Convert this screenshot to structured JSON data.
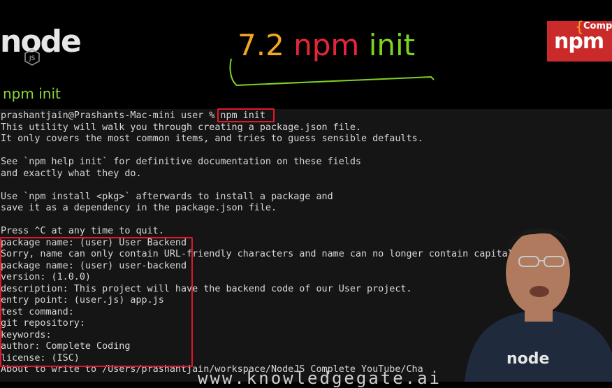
{
  "header": {
    "node_logo_text": "node",
    "slide_title_number": "7.2",
    "slide_title_cmd1": "npm",
    "slide_title_cmd2": "init",
    "subtitle": "npm init",
    "npm_badge_text": "npm",
    "npm_badge_tag": "Comp"
  },
  "terminal": {
    "lines": [
      "prashantjain@Prashants-Mac-mini user % npm init",
      "This utility will walk you through creating a package.json file.",
      "It only covers the most common items, and tries to guess sensible defaults.",
      "",
      "See `npm help init` for definitive documentation on these fields",
      "and exactly what they do.",
      "",
      "Use `npm install <pkg>` afterwards to install a package and",
      "save it as a dependency in the package.json file.",
      "",
      "Press ^C at any time to quit.",
      "package name: (user) User Backend",
      "Sorry, name can only contain URL-friendly characters and name can no longer contain capital",
      "package name: (user) user-backend",
      "version: (1.0.0)",
      "description: This project will have the backend code of our User project.",
      "entry point: (user.js) app.js",
      "test command:",
      "git repository:",
      "keywords:",
      "author: Complete Coding",
      "license: (ISC)",
      "About to write to /Users/prashantjain/workspace/NodeJS Complete YouTube/Cha"
    ]
  },
  "overlay": {
    "watermark": "www.knowledgegate.ai",
    "shirt_text": "node"
  },
  "colors": {
    "title_number": "#f5a623",
    "title_npm": "#e8253a",
    "title_init": "#7ed321",
    "highlight": "#e0182b",
    "subtitle": "#8bd43a"
  }
}
